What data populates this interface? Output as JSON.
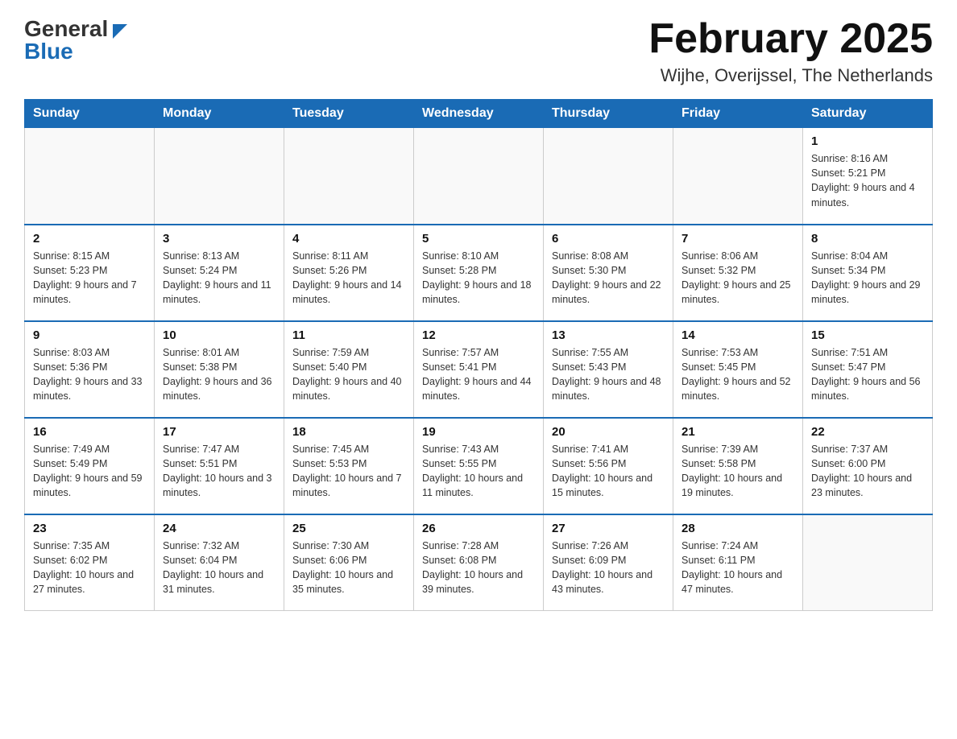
{
  "header": {
    "logo_general": "General",
    "logo_blue": "Blue",
    "title": "February 2025",
    "subtitle": "Wijhe, Overijssel, The Netherlands"
  },
  "weekdays": [
    "Sunday",
    "Monday",
    "Tuesday",
    "Wednesday",
    "Thursday",
    "Friday",
    "Saturday"
  ],
  "weeks": [
    [
      {
        "day": "",
        "info": ""
      },
      {
        "day": "",
        "info": ""
      },
      {
        "day": "",
        "info": ""
      },
      {
        "day": "",
        "info": ""
      },
      {
        "day": "",
        "info": ""
      },
      {
        "day": "",
        "info": ""
      },
      {
        "day": "1",
        "info": "Sunrise: 8:16 AM\nSunset: 5:21 PM\nDaylight: 9 hours and 4 minutes."
      }
    ],
    [
      {
        "day": "2",
        "info": "Sunrise: 8:15 AM\nSunset: 5:23 PM\nDaylight: 9 hours and 7 minutes."
      },
      {
        "day": "3",
        "info": "Sunrise: 8:13 AM\nSunset: 5:24 PM\nDaylight: 9 hours and 11 minutes."
      },
      {
        "day": "4",
        "info": "Sunrise: 8:11 AM\nSunset: 5:26 PM\nDaylight: 9 hours and 14 minutes."
      },
      {
        "day": "5",
        "info": "Sunrise: 8:10 AM\nSunset: 5:28 PM\nDaylight: 9 hours and 18 minutes."
      },
      {
        "day": "6",
        "info": "Sunrise: 8:08 AM\nSunset: 5:30 PM\nDaylight: 9 hours and 22 minutes."
      },
      {
        "day": "7",
        "info": "Sunrise: 8:06 AM\nSunset: 5:32 PM\nDaylight: 9 hours and 25 minutes."
      },
      {
        "day": "8",
        "info": "Sunrise: 8:04 AM\nSunset: 5:34 PM\nDaylight: 9 hours and 29 minutes."
      }
    ],
    [
      {
        "day": "9",
        "info": "Sunrise: 8:03 AM\nSunset: 5:36 PM\nDaylight: 9 hours and 33 minutes."
      },
      {
        "day": "10",
        "info": "Sunrise: 8:01 AM\nSunset: 5:38 PM\nDaylight: 9 hours and 36 minutes."
      },
      {
        "day": "11",
        "info": "Sunrise: 7:59 AM\nSunset: 5:40 PM\nDaylight: 9 hours and 40 minutes."
      },
      {
        "day": "12",
        "info": "Sunrise: 7:57 AM\nSunset: 5:41 PM\nDaylight: 9 hours and 44 minutes."
      },
      {
        "day": "13",
        "info": "Sunrise: 7:55 AM\nSunset: 5:43 PM\nDaylight: 9 hours and 48 minutes."
      },
      {
        "day": "14",
        "info": "Sunrise: 7:53 AM\nSunset: 5:45 PM\nDaylight: 9 hours and 52 minutes."
      },
      {
        "day": "15",
        "info": "Sunrise: 7:51 AM\nSunset: 5:47 PM\nDaylight: 9 hours and 56 minutes."
      }
    ],
    [
      {
        "day": "16",
        "info": "Sunrise: 7:49 AM\nSunset: 5:49 PM\nDaylight: 9 hours and 59 minutes."
      },
      {
        "day": "17",
        "info": "Sunrise: 7:47 AM\nSunset: 5:51 PM\nDaylight: 10 hours and 3 minutes."
      },
      {
        "day": "18",
        "info": "Sunrise: 7:45 AM\nSunset: 5:53 PM\nDaylight: 10 hours and 7 minutes."
      },
      {
        "day": "19",
        "info": "Sunrise: 7:43 AM\nSunset: 5:55 PM\nDaylight: 10 hours and 11 minutes."
      },
      {
        "day": "20",
        "info": "Sunrise: 7:41 AM\nSunset: 5:56 PM\nDaylight: 10 hours and 15 minutes."
      },
      {
        "day": "21",
        "info": "Sunrise: 7:39 AM\nSunset: 5:58 PM\nDaylight: 10 hours and 19 minutes."
      },
      {
        "day": "22",
        "info": "Sunrise: 7:37 AM\nSunset: 6:00 PM\nDaylight: 10 hours and 23 minutes."
      }
    ],
    [
      {
        "day": "23",
        "info": "Sunrise: 7:35 AM\nSunset: 6:02 PM\nDaylight: 10 hours and 27 minutes."
      },
      {
        "day": "24",
        "info": "Sunrise: 7:32 AM\nSunset: 6:04 PM\nDaylight: 10 hours and 31 minutes."
      },
      {
        "day": "25",
        "info": "Sunrise: 7:30 AM\nSunset: 6:06 PM\nDaylight: 10 hours and 35 minutes."
      },
      {
        "day": "26",
        "info": "Sunrise: 7:28 AM\nSunset: 6:08 PM\nDaylight: 10 hours and 39 minutes."
      },
      {
        "day": "27",
        "info": "Sunrise: 7:26 AM\nSunset: 6:09 PM\nDaylight: 10 hours and 43 minutes."
      },
      {
        "day": "28",
        "info": "Sunrise: 7:24 AM\nSunset: 6:11 PM\nDaylight: 10 hours and 47 minutes."
      },
      {
        "day": "",
        "info": ""
      }
    ]
  ]
}
